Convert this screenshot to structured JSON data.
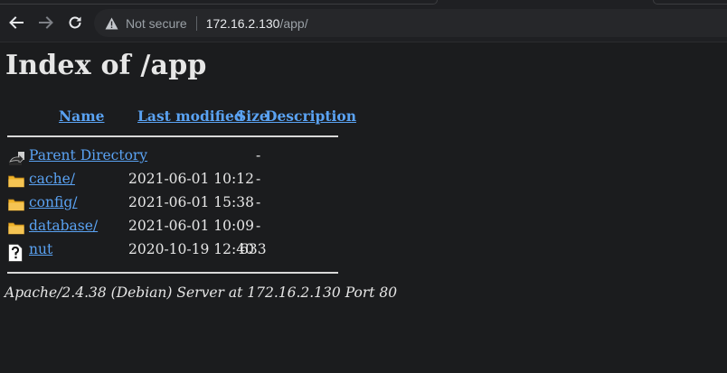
{
  "browser": {
    "security_label": "Not secure",
    "url_host": "172.16.2.130",
    "url_path": "/app/"
  },
  "page": {
    "title": "Index of /app",
    "columns": {
      "name": "Name",
      "last_modified": "Last modified",
      "size": "Size",
      "description": "Description"
    },
    "rows": [
      {
        "icon": "back-icon",
        "name": "Parent Directory",
        "modified": "",
        "size": "-"
      },
      {
        "icon": "folder-icon",
        "name": "cache/",
        "modified": "2021-06-01 10:12",
        "size": "-"
      },
      {
        "icon": "folder-icon",
        "name": "config/",
        "modified": "2021-06-01 15:38",
        "size": "-"
      },
      {
        "icon": "folder-icon",
        "name": "database/",
        "modified": "2021-06-01 10:09",
        "size": "-"
      },
      {
        "icon": "unknown-file-icon",
        "name": "nut",
        "modified": "2020-10-19 12:40",
        "size": "633"
      }
    ],
    "footer": "Apache/2.4.38 (Debian) Server at 172.16.2.130 Port 80"
  },
  "colors": {
    "background": "#1b1c1e",
    "link": "#5aa2f2",
    "text": "#e6e6e6",
    "folder": "#f0b429"
  }
}
